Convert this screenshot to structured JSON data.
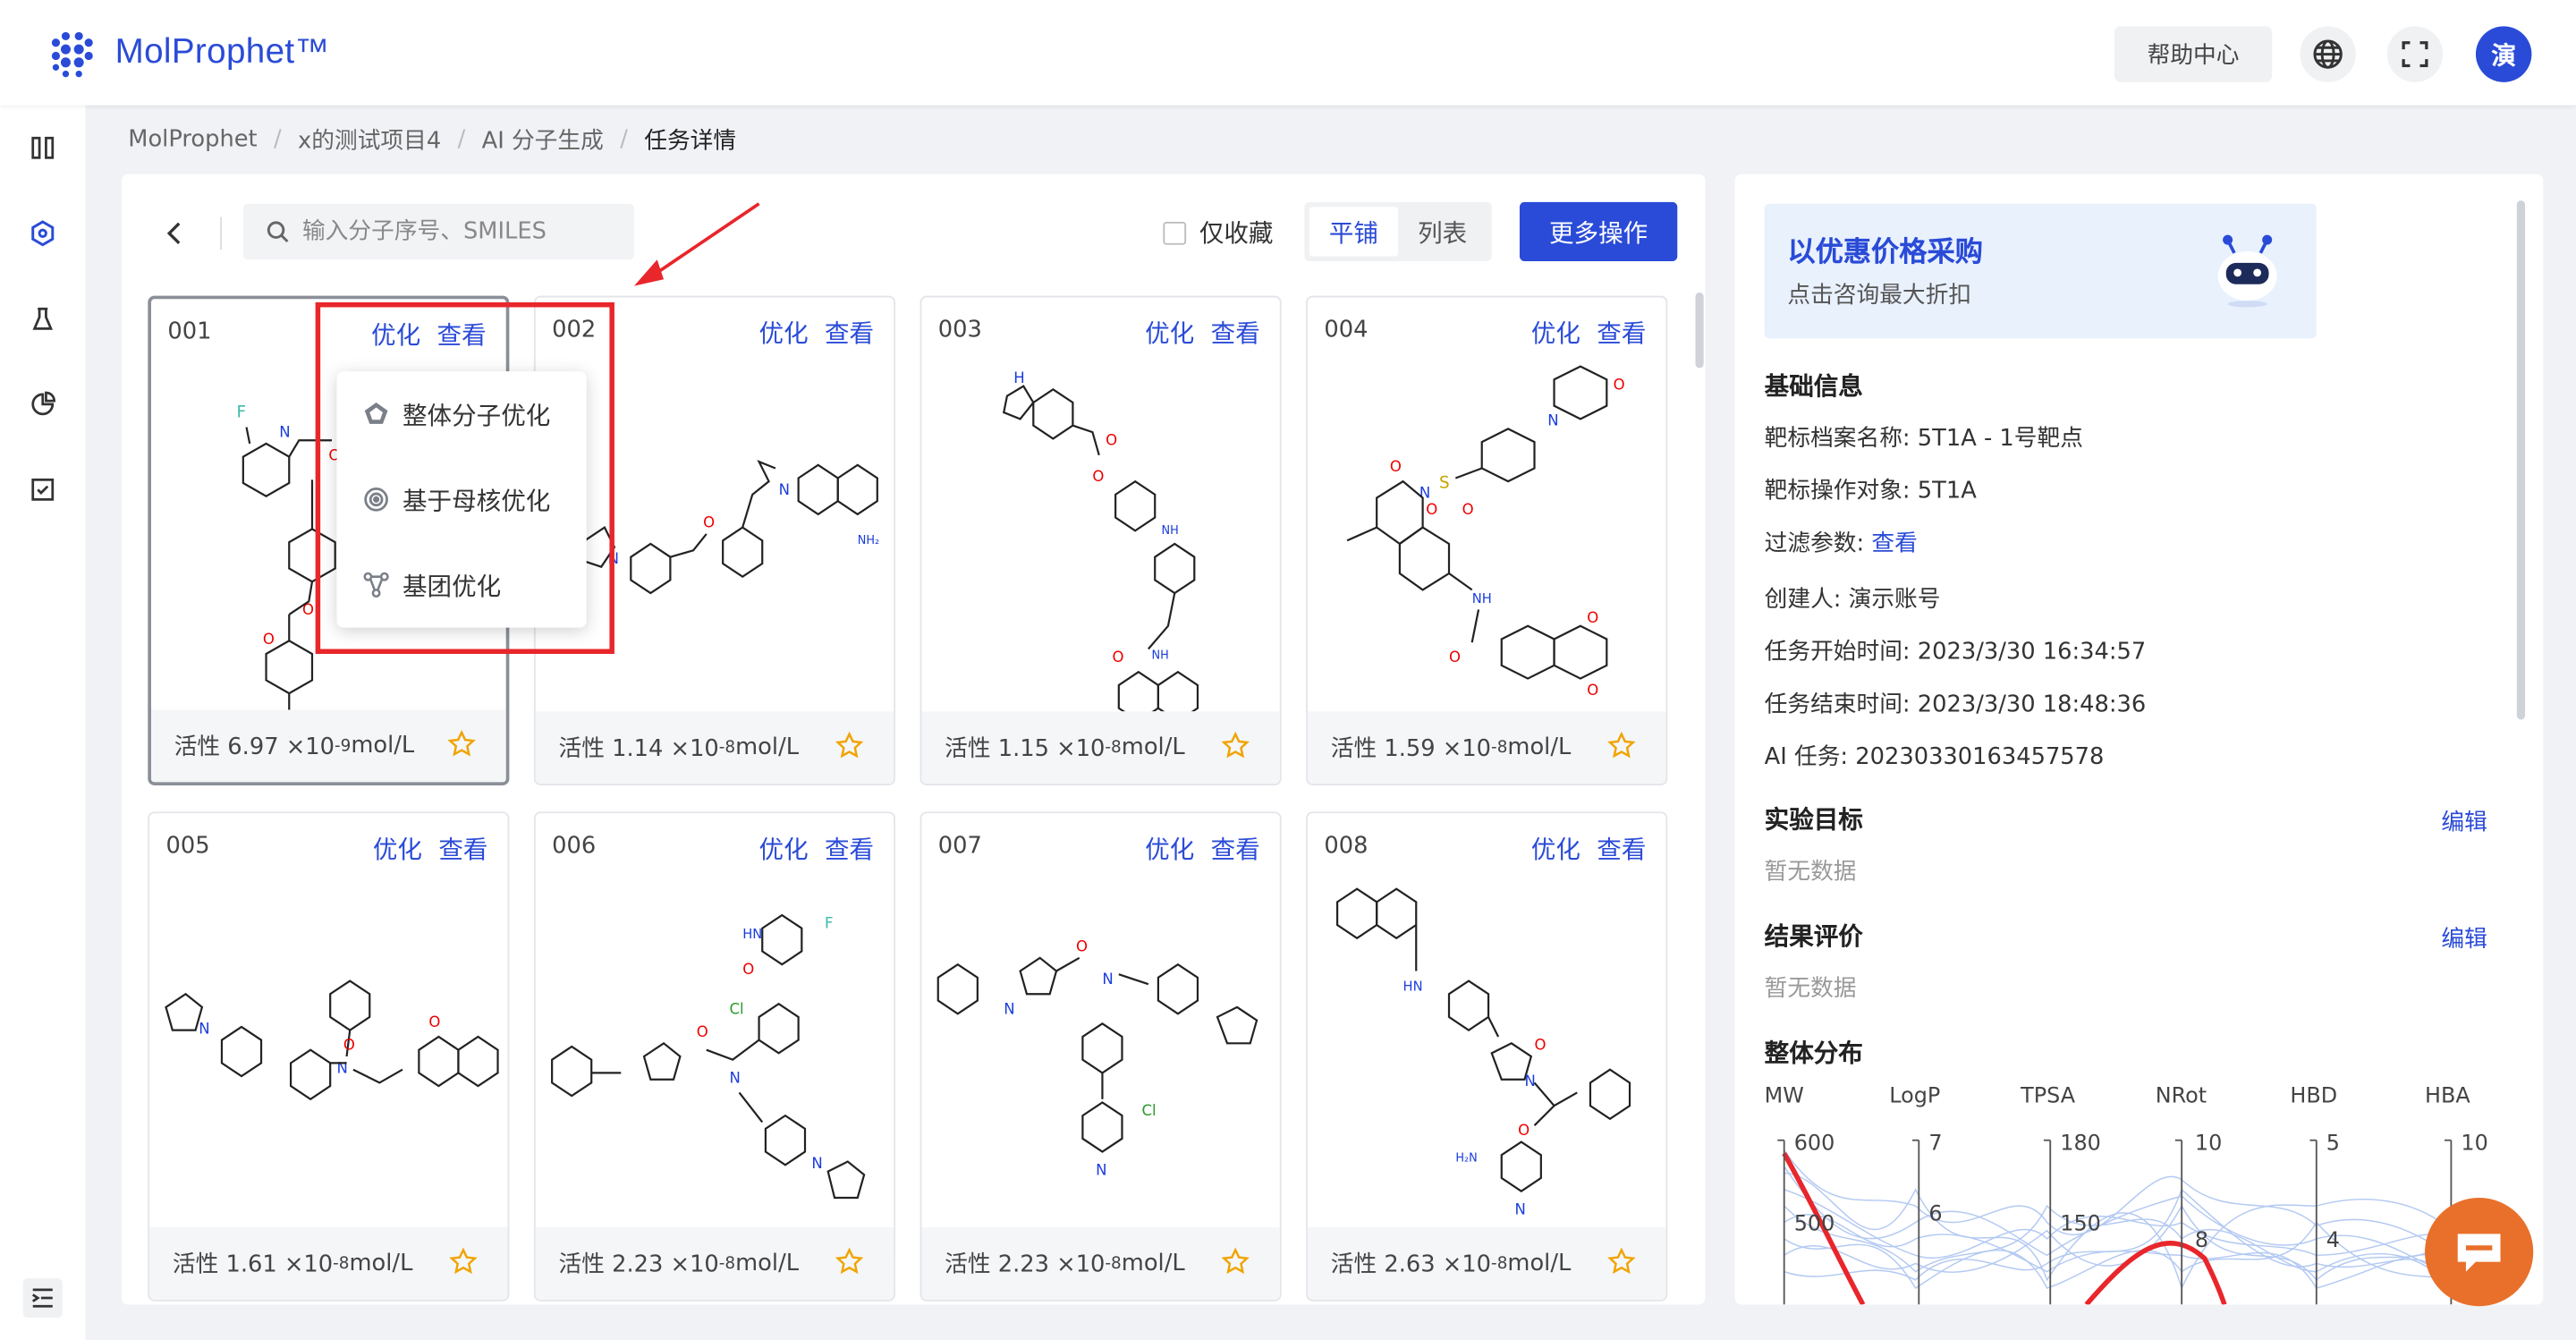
{
  "app": {
    "name": "MolProphet™",
    "brand_color": "#2a4bd7"
  },
  "header": {
    "help_label": "帮助中心",
    "avatar_initial": "演"
  },
  "breadcrumb": [
    "MolProphet",
    "x的测试项目4",
    "AI 分子生成",
    "任务详情"
  ],
  "toolbar": {
    "search_placeholder": "输入分子序号、SMILES",
    "fav_only_label": "仅收藏",
    "view_tile": "平铺",
    "view_list": "列表",
    "more_label": "更多操作"
  },
  "cards": [
    {
      "id": "001",
      "optimize": "优化",
      "view": "查看",
      "activity_prefix": "活性 6.97 ×10",
      "exp": "-9",
      "unit": " mol/L"
    },
    {
      "id": "002",
      "optimize": "优化",
      "view": "查看",
      "activity_prefix": "活性 1.14 ×10",
      "exp": "-8",
      "unit": " mol/L"
    },
    {
      "id": "003",
      "optimize": "优化",
      "view": "查看",
      "activity_prefix": "活性 1.15 ×10",
      "exp": "-8",
      "unit": " mol/L"
    },
    {
      "id": "004",
      "optimize": "优化",
      "view": "查看",
      "activity_prefix": "活性 1.59 ×10",
      "exp": "-8",
      "unit": " mol/L"
    },
    {
      "id": "005",
      "optimize": "优化",
      "view": "查看",
      "activity_prefix": "活性 1.61 ×10",
      "exp": "-8",
      "unit": " mol/L"
    },
    {
      "id": "006",
      "optimize": "优化",
      "view": "查看",
      "activity_prefix": "活性 2.23 ×10",
      "exp": "-8",
      "unit": " mol/L"
    },
    {
      "id": "007",
      "optimize": "优化",
      "view": "查看",
      "activity_prefix": "活性 2.23 ×10",
      "exp": "-8",
      "unit": " mol/L"
    },
    {
      "id": "008",
      "optimize": "优化",
      "view": "查看",
      "activity_prefix": "活性 2.63 ×10",
      "exp": "-8",
      "unit": " mol/L"
    }
  ],
  "dropdown": {
    "items": [
      "整体分子优化",
      "基于母核优化",
      "基团优化"
    ]
  },
  "promo": {
    "title": "以优惠价格采购",
    "subtitle": "点击咨询最大折扣"
  },
  "basic_info": {
    "title": "基础信息",
    "target_name": "靶标档案名称: 5T1A - 1号靶点",
    "target_object": "靶标操作对象: 5T1A",
    "filter_label": "过滤参数:",
    "filter_link": "查看",
    "creator": "创建人: 演示账号",
    "start_time": "任务开始时间: 2023/3/30 16:34:57",
    "end_time": "任务结束时间: 2023/3/30 18:48:36",
    "ai_task": "AI 任务: 20230330163457578"
  },
  "experiment": {
    "title": "实验目标",
    "edit": "编辑",
    "empty": "暂无数据"
  },
  "evaluation": {
    "title": "结果评价",
    "edit": "编辑",
    "empty": "暂无数据"
  },
  "distribution": {
    "title": "整体分布",
    "axes": [
      {
        "name": "MW",
        "ticks": [
          "600",
          "500"
        ]
      },
      {
        "name": "LogP",
        "ticks": [
          "7",
          "6"
        ]
      },
      {
        "name": "TPSA",
        "ticks": [
          "180",
          "150"
        ]
      },
      {
        "name": "NRot",
        "ticks": [
          "10",
          "8"
        ]
      },
      {
        "name": "HBD",
        "ticks": [
          "5",
          "4"
        ]
      },
      {
        "name": "HBA",
        "ticks": [
          "10"
        ]
      }
    ]
  }
}
